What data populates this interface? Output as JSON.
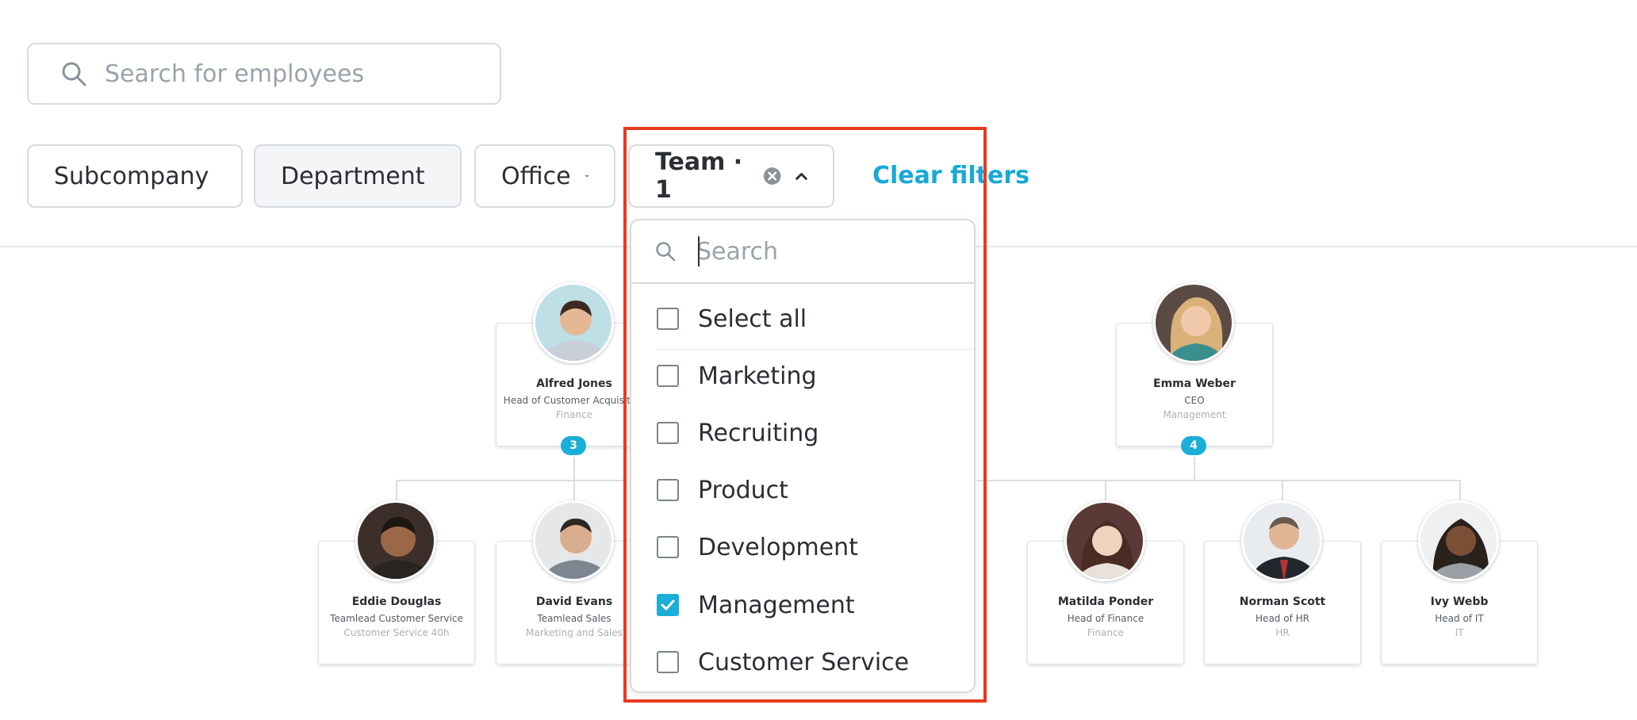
{
  "search": {
    "placeholder": "Search for employees"
  },
  "filters": {
    "subcompany": "Subcompany",
    "department": "Department",
    "office": "Office",
    "team": "Team · 1",
    "clear_label": "Clear filters"
  },
  "dropdown": {
    "search_placeholder": "Search",
    "options": [
      {
        "label": "Select all",
        "checked": false
      },
      {
        "label": "Marketing",
        "checked": false
      },
      {
        "label": "Recruiting",
        "checked": false
      },
      {
        "label": "Product",
        "checked": false
      },
      {
        "label": "Development",
        "checked": false
      },
      {
        "label": "Management",
        "checked": true
      },
      {
        "label": "Customer Service",
        "checked": false
      }
    ]
  },
  "org": {
    "alfred": {
      "name": "Alfred Jones",
      "role": "Head of Customer Acquisition",
      "dept": "Finance",
      "reports": "3"
    },
    "emma": {
      "name": "Emma Weber",
      "role": "CEO",
      "dept": "Management",
      "reports": "4"
    },
    "eddie": {
      "name": "Eddie Douglas",
      "role": "Teamlead Customer Service",
      "dept": "Customer Service 40h"
    },
    "david": {
      "name": "David Evans",
      "role": "Teamlead Sales",
      "dept": "Marketing and Sales"
    },
    "matilda": {
      "name": "Matilda Ponder",
      "role": "Head of Finance",
      "dept": "Finance"
    },
    "norman": {
      "name": "Norman Scott",
      "role": "Head of HR",
      "dept": "HR"
    },
    "ivy": {
      "name": "Ivy Webb",
      "role": "Head of IT",
      "dept": "IT"
    }
  },
  "colors": {
    "accent": "#1aaed8",
    "highlight": "#e8391f",
    "border": "#d6dbe0"
  },
  "icons": [
    "search-icon",
    "chevron-down-icon",
    "chevron-up-icon",
    "clear-filter-icon",
    "checkmark-icon"
  ]
}
